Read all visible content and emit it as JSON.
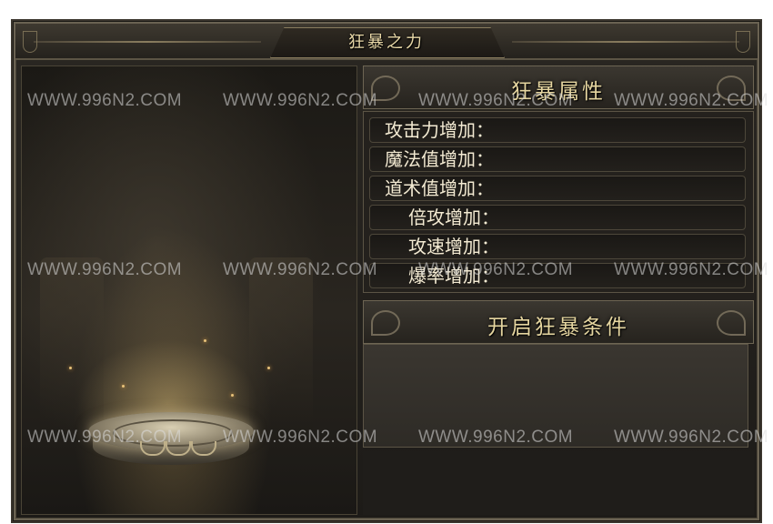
{
  "window": {
    "title": "狂暴之力"
  },
  "attributes": {
    "header": "狂暴属性",
    "rows": [
      {
        "label": "攻击力增加：",
        "value": ""
      },
      {
        "label": "魔法值增加：",
        "value": ""
      },
      {
        "label": "道术值增加：",
        "value": ""
      },
      {
        "label": "倍攻增加：",
        "value": ""
      },
      {
        "label": "攻速增加：",
        "value": ""
      },
      {
        "label": "爆率增加：",
        "value": ""
      }
    ]
  },
  "conditions": {
    "header": "开启狂暴条件",
    "text": ""
  },
  "watermark": {
    "text": "WWW.996N2.COM"
  },
  "colors": {
    "gold_text": "#e6d6a0",
    "label_text": "#f3ead2",
    "frame": "#6d6553"
  }
}
